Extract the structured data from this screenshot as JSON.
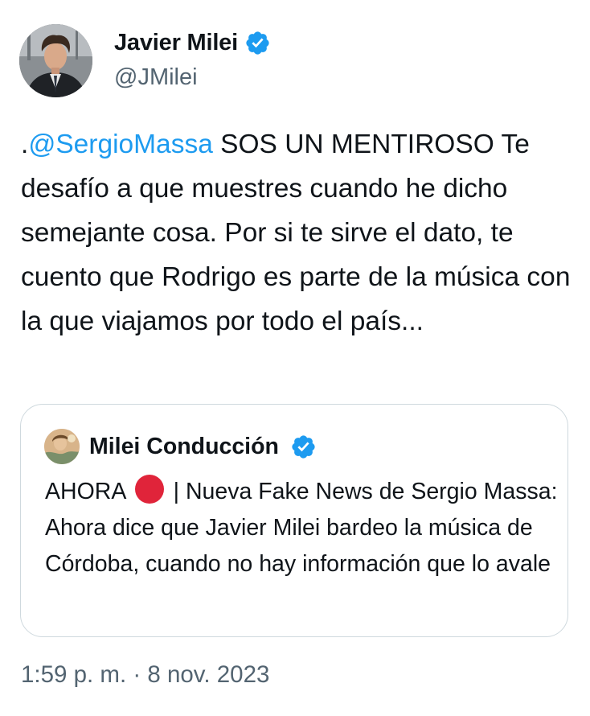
{
  "author": {
    "display_name": "Javier Milei",
    "handle": "@JMilei",
    "verified_icon": "verified-badge-icon"
  },
  "tweet": {
    "prefix": ".",
    "mention": "@SergioMassa",
    "text_after_mention": " SOS UN MENTIROSO Te desafío a que muestres cuando he dicho semejante cosa. Por si te sirve el dato, te cuento que Rodrigo es parte de la música con la que viajamos por todo el país..."
  },
  "quoted_tweet": {
    "display_name": "Milei Conducción",
    "verified_icon": "verified-badge-icon",
    "text_before_emoji": "AHORA",
    "emoji": "red-circle-icon",
    "text_after_emoji": " | Nueva Fake News de Sergio Massa: Ahora dice que Javier Milei bardeo la música de Córdoba, cuando no hay información que lo avale"
  },
  "timestamp": "1:59 p. m. · 8 nov. 2023",
  "colors": {
    "link": "#1d9bf0",
    "verified": "#1d9bf0",
    "secondary_text": "#536471",
    "border": "#cfd9de",
    "red_circle": "#e0243a"
  }
}
